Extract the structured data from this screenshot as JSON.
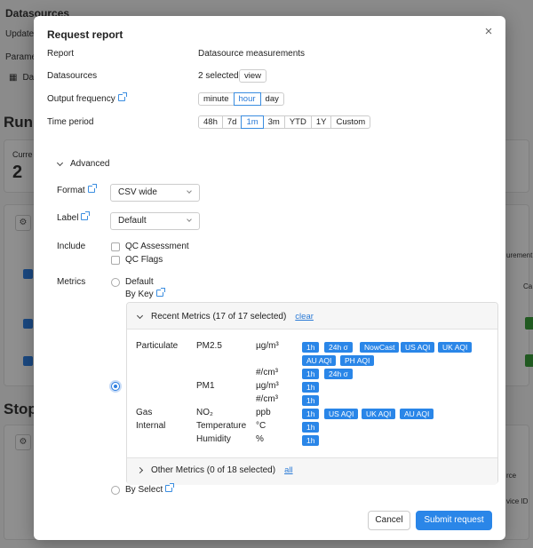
{
  "background": {
    "title": "Datasources",
    "updated": "Updated",
    "parameters": "Paramet",
    "datasource_item": "Dat",
    "running_heading": "Runn",
    "current_label": "Curre",
    "current_value": "2",
    "stopped_heading": "Stop",
    "right_label_1": "urement:",
    "right_label_2": "Ca",
    "right_label_3": "rce",
    "right_label_4": "vice ID"
  },
  "modal": {
    "title": "Request report",
    "close_glyph": "×",
    "report_label": "Report",
    "report_value": "Datasource measurements",
    "datasources_label": "Datasources",
    "datasources_selected": "2 selected",
    "view_label": "view",
    "output_frequency_label": "Output frequency",
    "frequency_options": [
      "minute",
      "hour",
      "day"
    ],
    "time_period_label": "Time period",
    "time_options": [
      "48h",
      "7d",
      "1m",
      "3m",
      "YTD",
      "1Y",
      "Custom"
    ],
    "advanced_label": "Advanced",
    "format_label": "Format",
    "format_value": "CSV wide",
    "label_label": "Label",
    "label_value": "Default",
    "include_label": "Include",
    "include_options": [
      "QC Assessment",
      "QC Flags"
    ],
    "metrics_label": "Metrics",
    "metrics_default": "Default",
    "metrics_by_key": "By Key",
    "metrics_by_select": "By Select",
    "recent_metrics_label": "Recent Metrics (17 of 17 selected)",
    "clear_label": "clear",
    "other_metrics_label": "Other Metrics (0 of 18 selected)",
    "all_label": "all",
    "rows": [
      {
        "group": "Particulate",
        "metric": "PM2.5",
        "unit": "µg/m³",
        "chips": [
          "1h",
          "24h σ",
          "NowCast",
          "US AQI",
          "UK AQI",
          "AU AQI",
          "PH AQI"
        ]
      },
      {
        "group": "",
        "metric": "",
        "unit": "#/cm³",
        "chips": [
          "1h",
          "24h σ"
        ]
      },
      {
        "group": "",
        "metric": "PM1",
        "unit": "µg/m³",
        "chips": [
          "1h"
        ]
      },
      {
        "group": "",
        "metric": "",
        "unit": "#/cm³",
        "chips": [
          "1h"
        ]
      },
      {
        "group": "Gas",
        "metric": "NO₂",
        "unit": "ppb",
        "chips": [
          "1h",
          "US AQI",
          "UK AQI",
          "AU AQI"
        ]
      },
      {
        "group": "Internal",
        "metric": "Temperature",
        "unit": "°C",
        "chips": [
          "1h"
        ]
      },
      {
        "group": "",
        "metric": "Humidity",
        "unit": "%",
        "chips": [
          "1h"
        ]
      }
    ],
    "cancel_label": "Cancel",
    "submit_label": "Submit request"
  },
  "colors": {
    "accent": "#2a86e8",
    "link": "#2a7ad6",
    "status_green": "#3a9a3a"
  }
}
